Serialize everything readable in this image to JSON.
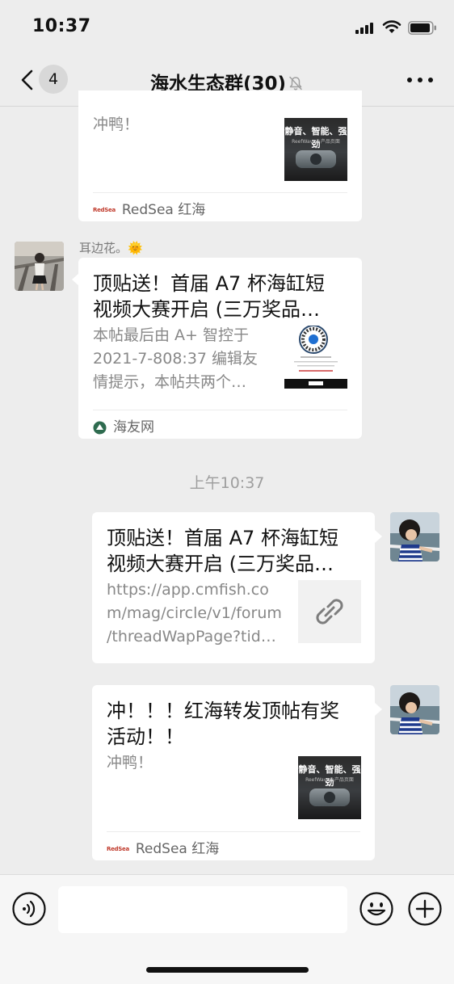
{
  "status_bar": {
    "time": "10:37"
  },
  "nav": {
    "unread_count": "4",
    "title": "海水生态群(30)"
  },
  "messages": [
    {
      "id": "m1",
      "direction": "incoming",
      "desc": "冲鸭！",
      "thumb": {
        "title": "静音、智能、强劲",
        "subtitle": "ReefWave®产品页面"
      },
      "source": "RedSea 红海",
      "source_logo": "RedSea"
    },
    {
      "id": "m2",
      "direction": "incoming",
      "sender": "耳边花。🌞",
      "title_lines": [
        "顶贴送！首届 A7 杯海缸短",
        "视频大赛开启 (三万奖品…"
      ],
      "desc_lines": [
        "本帖最后由 A+ 智控于",
        "2021-7-808:37 编辑友",
        "情提示，本帖共两个…"
      ],
      "source": "海友网"
    },
    {
      "id": "t1",
      "type": "time",
      "text": "上午10:37"
    },
    {
      "id": "m3",
      "direction": "outgoing",
      "title_lines": [
        "顶贴送！首届 A7 杯海缸短",
        "视频大赛开启 (三万奖品…"
      ],
      "desc_lines": [
        "https://app.cmfish.co",
        "m/mag/circle/v1/forum",
        "/threadWapPage?tid…"
      ]
    },
    {
      "id": "m4",
      "direction": "outgoing",
      "title_lines": [
        "冲！！！红海转发顶帖有奖",
        "活动！！"
      ],
      "desc": "冲鸭！",
      "thumb": {
        "title": "静音、智能、强劲",
        "subtitle": "ReefWave®产品页面"
      },
      "source": "RedSea 红海",
      "source_logo": "RedSea"
    }
  ],
  "input": {
    "value": "",
    "placeholder": ""
  },
  "icons": {
    "signal": "signal-icon",
    "wifi": "wifi-icon",
    "battery": "battery-icon",
    "back": "chevron-left-icon",
    "mute": "mute-bell-icon",
    "more": "more-icon",
    "voice": "voice-icon",
    "emoji": "emoji-icon",
    "plus": "plus-icon",
    "link": "link-icon"
  },
  "colors": {
    "background": "#ededed",
    "card": "#ffffff",
    "text": "#111111",
    "secondary_text": "#888888"
  }
}
